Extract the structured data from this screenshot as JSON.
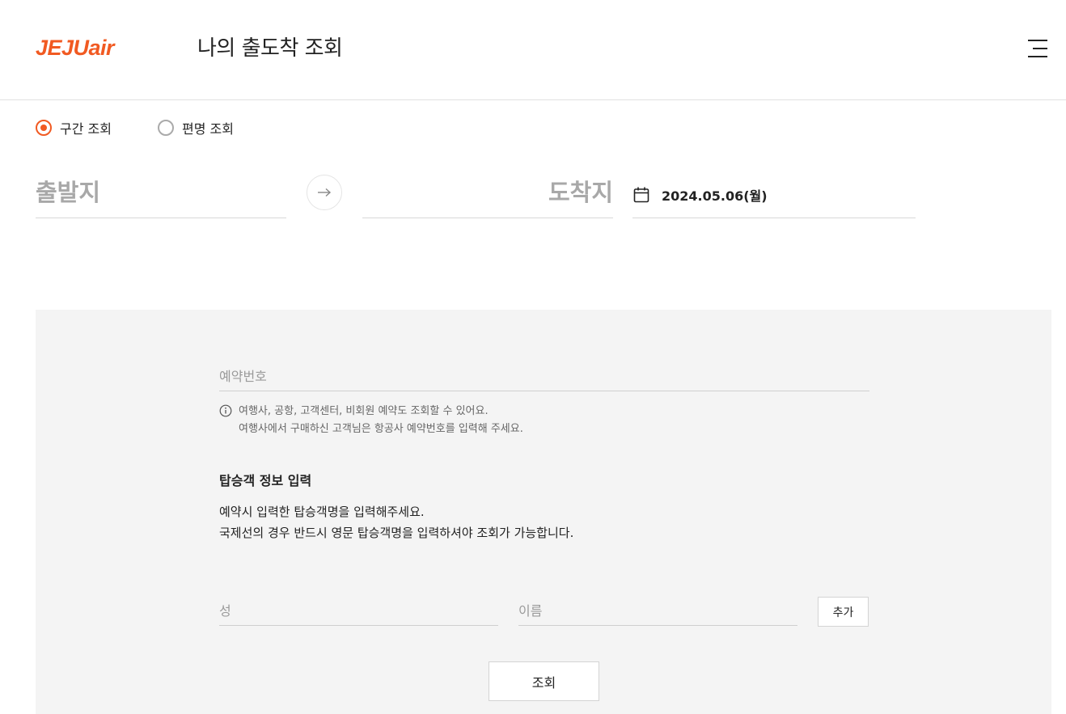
{
  "header": {
    "logo_text": "JEJUair",
    "title": "나의 출도착 조회",
    "menu_icon": "hamburger-menu-icon"
  },
  "search_type": {
    "options": [
      {
        "label": "구간 조회",
        "selected": true
      },
      {
        "label": "편명 조회",
        "selected": false
      }
    ]
  },
  "route": {
    "departure_placeholder": "출발지",
    "arrival_placeholder": "도착지",
    "swap_icon": "arrow-right-icon",
    "date": "2024.05.06(월)",
    "date_icon": "calendar-icon"
  },
  "reservation": {
    "placeholder": "예약번호",
    "notice_lines": [
      "여행사, 공항, 고객센터, 비회원 예약도 조회할 수 있어요.",
      "여행사에서 구매하신 고객님은 항공사 예약번호를 입력해 주세요."
    ]
  },
  "passenger": {
    "title": "탑승객 정보 입력",
    "desc_lines": [
      "예약시 입력한 탑승객명을 입력해주세요.",
      "국제선의 경우 반드시 영문 탑승객명을 입력하셔야 조회가 가능합니다."
    ],
    "last_name_placeholder": "성",
    "first_name_placeholder": "이름",
    "add_label": "추가"
  },
  "submit_label": "조회",
  "colors": {
    "brand": "#f15a22",
    "panel_bg": "#f4f4f4",
    "placeholder": "#a8a8a8"
  }
}
